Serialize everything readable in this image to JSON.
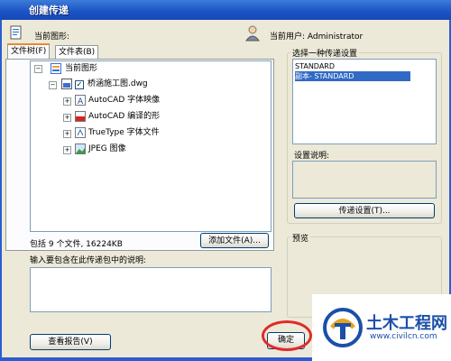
{
  "window": {
    "title": "创建传递"
  },
  "header": {
    "current_drawing_label": "当前图形:",
    "current_user_label": "当前用户: Administrator"
  },
  "tabs": [
    {
      "label": "文件树(F)",
      "active": true
    },
    {
      "label": "文件表(B)",
      "active": false
    }
  ],
  "tree": {
    "root": "当前图形",
    "drawing": "桥涵施工图.dwg",
    "children": [
      {
        "label": "AutoCAD 字体映像",
        "icon": "autocad-doc-icon"
      },
      {
        "label": "AutoCAD 编译的形",
        "icon": "shx-icon"
      },
      {
        "label": "TrueType 字体文件",
        "icon": "truetype-icon"
      },
      {
        "label": "JPEG 图像",
        "icon": "image-icon"
      }
    ]
  },
  "summary": "包括 9 个文件, 16224KB",
  "buttons": {
    "add_file": "添加文件(A)...",
    "transmittal_setups": "传递设置(T)...",
    "view_report": "查看报告(V)",
    "ok": "确定"
  },
  "notes_label": "输入要包含在此传递包中的说明:",
  "setups": {
    "group_label": "选择一种传递设置",
    "items": [
      "STANDARD",
      "副本- STANDARD"
    ],
    "selected_index": 1
  },
  "description_label": "设置说明:",
  "preview_label": "预览",
  "watermark": {
    "name": "土木工程网",
    "url": "www.civilcn.com"
  },
  "colors": {
    "title_bar": "#1a53c4",
    "selection": "#316ac5",
    "highlight_ring": "#e02a2a",
    "watermark_blue": "#1b4fa8"
  }
}
